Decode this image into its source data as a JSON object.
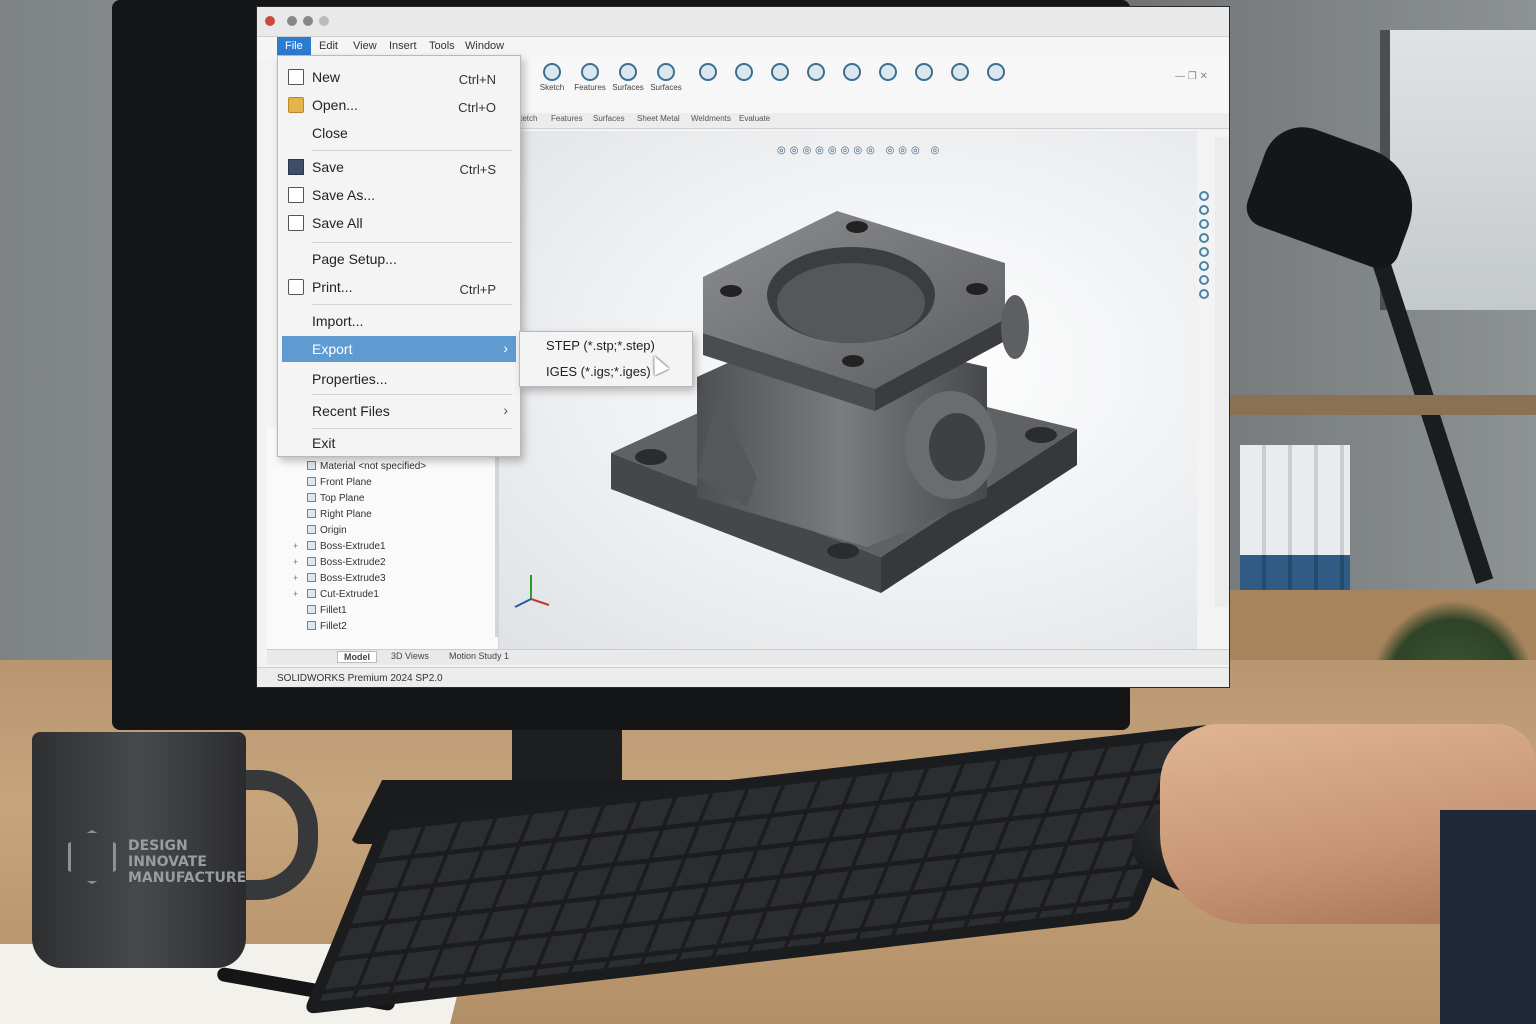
{
  "menubar": {
    "items": [
      "File",
      "Edit",
      "View",
      "Insert",
      "Tools",
      "Window"
    ]
  },
  "ribbon": {
    "buttons": [
      "Sketch",
      "Features",
      "Surfaces",
      "Surfaces"
    ]
  },
  "tabs": [
    "Sketch",
    "Features",
    "Surfaces",
    "Sheet Metal",
    "Weldments",
    "Evaluate"
  ],
  "file_menu": {
    "new": {
      "label": "New",
      "shortcut": "Ctrl+N"
    },
    "open": {
      "label": "Open...",
      "shortcut": "Ctrl+O"
    },
    "close": {
      "label": "Close"
    },
    "save": {
      "label": "Save",
      "shortcut": "Ctrl+S"
    },
    "save_as": {
      "label": "Save As..."
    },
    "save_all": {
      "label": "Save All"
    },
    "page_setup": {
      "label": "Page Setup..."
    },
    "print": {
      "label": "Print...",
      "shortcut": "Ctrl+P"
    },
    "import": {
      "label": "Import..."
    },
    "export": {
      "label": "Export",
      "arrow": "›"
    },
    "properties": {
      "label": "Properties..."
    },
    "recent_files": {
      "label": "Recent Files",
      "arrow": "›"
    },
    "exit": {
      "label": "Exit"
    }
  },
  "export_submenu": {
    "step": "STEP (*.stp;*.step)",
    "iges": "IGES (*.igs;*.iges)"
  },
  "feature_tree": {
    "items": [
      {
        "label": "Material <not specified>",
        "icon": "material-icon"
      },
      {
        "label": "Front Plane",
        "icon": "plane-icon"
      },
      {
        "label": "Top Plane",
        "icon": "plane-icon"
      },
      {
        "label": "Right Plane",
        "icon": "plane-icon"
      },
      {
        "label": "Origin",
        "icon": "origin-icon"
      },
      {
        "label": "Boss-Extrude1",
        "icon": "extrude-icon",
        "expandable": true
      },
      {
        "label": "Boss-Extrude2",
        "icon": "extrude-icon",
        "expandable": true
      },
      {
        "label": "Boss-Extrude3",
        "icon": "extrude-icon",
        "expandable": true
      },
      {
        "label": "Cut-Extrude1",
        "icon": "cut-icon",
        "expandable": true
      },
      {
        "label": "Fillet1",
        "icon": "fillet-icon"
      },
      {
        "label": "Fillet2",
        "icon": "fillet-icon"
      }
    ]
  },
  "bottom_tabs": [
    "Model",
    "3D Views",
    "Motion Study 1"
  ],
  "status": {
    "text": "SOLIDWORKS Premium 2024 SP2.0"
  },
  "mug": {
    "line1": "DESIGN",
    "line2": "INNOVATE",
    "line3": "MANUFACTURE"
  },
  "colors": {
    "accent": "#2b7bd1",
    "highlight": "#5f9bd1",
    "part": "#6f7175"
  }
}
